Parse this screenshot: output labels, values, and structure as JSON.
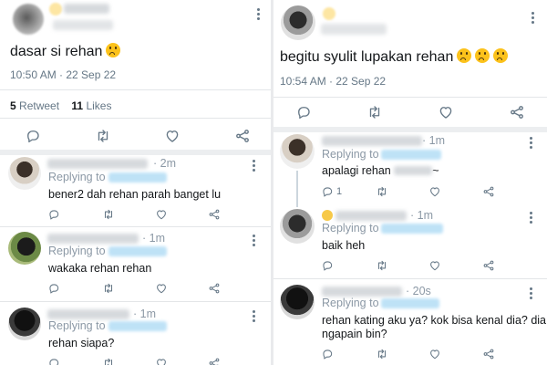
{
  "left": {
    "main": {
      "text": "dasar si rehan",
      "emoji": "worried-face",
      "time": "10:50 AM",
      "date": "22 Sep 22",
      "retweets": "5",
      "retweets_label": "Retweet",
      "likes": "11",
      "likes_label": "Likes"
    },
    "replies": [
      {
        "time": "2m",
        "replying": "Replying to",
        "body": "bener2 dah rehan parah banget lu"
      },
      {
        "time": "1m",
        "replying": "Replying to",
        "body": "wakaka rehan rehan"
      },
      {
        "time": "1m",
        "replying": "Replying to",
        "body": "rehan siapa?"
      }
    ]
  },
  "right": {
    "main": {
      "text": "begitu syulit lupakan rehan",
      "emoji": "worried-face",
      "time": "10:54 AM",
      "date": "22 Sep 22"
    },
    "replies": [
      {
        "time": "1m",
        "replying": "Replying to",
        "body": "apalagi rehan",
        "body_suffix": "~",
        "reply_count": "1"
      },
      {
        "time": "1m",
        "replying": "Replying to",
        "body": "baik heh"
      },
      {
        "time": "20s",
        "replying": "Replying to",
        "body": "rehan kating aku ya? kok bisa kenal dia? dia",
        "body2": "ngapain bin?"
      }
    ]
  },
  "colors": {
    "text": "#14171a",
    "secondary": "#657786",
    "mention": "#1da1f2",
    "divider": "#e3e6e8"
  },
  "icons": [
    "reply-icon",
    "retweet-icon",
    "like-icon",
    "share-icon",
    "more-icon"
  ]
}
